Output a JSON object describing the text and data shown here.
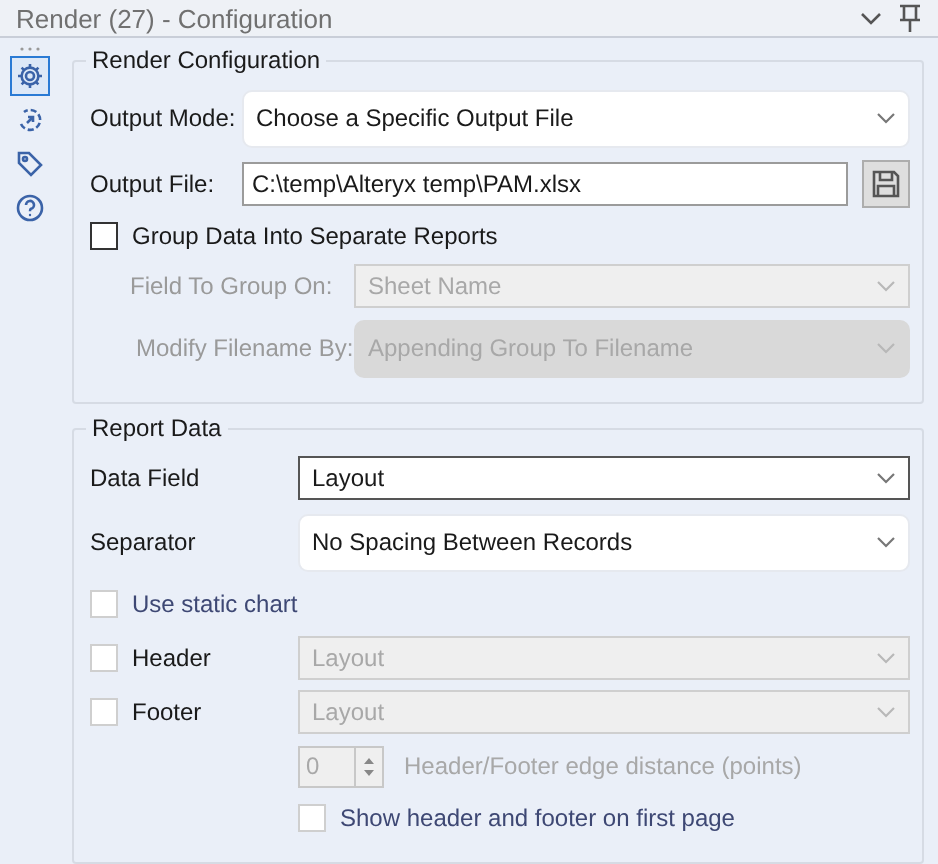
{
  "panel": {
    "title": "Render (27) - Configuration"
  },
  "sidebar": {
    "items": [
      {
        "kind": "gear",
        "selected": true
      },
      {
        "kind": "arrow",
        "selected": false
      },
      {
        "kind": "tag",
        "selected": false
      },
      {
        "kind": "help",
        "selected": false
      }
    ]
  },
  "render_configuration": {
    "title": "Render Configuration",
    "output_mode": {
      "label": "Output Mode:",
      "value": "Choose a Specific Output File",
      "kind": "rounded",
      "disabled": false
    },
    "output_file": {
      "label": "Output File:",
      "value": "C:\\temp\\Alteryx temp\\PAM.xlsx"
    },
    "group_data": {
      "label": "Group Data Into Separate Reports",
      "checked": false,
      "disabled": false
    },
    "field_to_group_on": {
      "label": "Field To Group On:",
      "value": "Sheet Name",
      "disabled": true
    },
    "modify_filename_by": {
      "label": "Modify Filename By:",
      "value": "Appending Group To Filename",
      "kind": "rounded",
      "disabled": true
    }
  },
  "report_data": {
    "title": "Report Data",
    "data_field": {
      "label": "Data Field",
      "value": "Layout",
      "disabled": false,
      "focused": true
    },
    "separator": {
      "label": "Separator",
      "value": "No Spacing Between Records",
      "kind": "rounded",
      "disabled": false
    },
    "use_static_chart": {
      "label": "Use static chart",
      "checked": false,
      "disabled": true
    },
    "header": {
      "label": "Header",
      "checked": false,
      "value": "Layout",
      "disabled": true
    },
    "footer": {
      "label": "Footer",
      "checked": false,
      "value": "Layout",
      "disabled": true
    },
    "edge_distance": {
      "value": "0",
      "label": "Header/Footer edge distance (points)",
      "disabled": true
    },
    "show_first_page": {
      "label": "Show header and footer on first page",
      "checked": false,
      "disabled": true
    }
  }
}
